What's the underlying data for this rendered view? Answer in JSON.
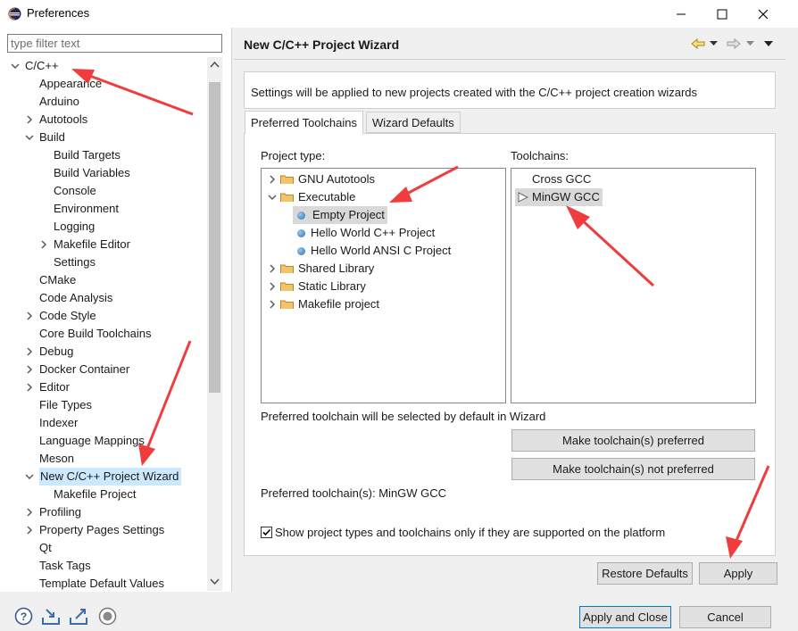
{
  "window": {
    "title": "Preferences"
  },
  "filter": {
    "placeholder": "type filter text"
  },
  "tree": [
    {
      "label": "C/C++",
      "level": 0,
      "arrow": "down"
    },
    {
      "label": "Appearance",
      "level": 1,
      "arrow": ""
    },
    {
      "label": "Arduino",
      "level": 1,
      "arrow": ""
    },
    {
      "label": "Autotools",
      "level": 1,
      "arrow": "right"
    },
    {
      "label": "Build",
      "level": 1,
      "arrow": "down"
    },
    {
      "label": "Build Targets",
      "level": 2,
      "arrow": ""
    },
    {
      "label": "Build Variables",
      "level": 2,
      "arrow": ""
    },
    {
      "label": "Console",
      "level": 2,
      "arrow": ""
    },
    {
      "label": "Environment",
      "level": 2,
      "arrow": ""
    },
    {
      "label": "Logging",
      "level": 2,
      "arrow": ""
    },
    {
      "label": "Makefile Editor",
      "level": 2,
      "arrow": "right"
    },
    {
      "label": "Settings",
      "level": 2,
      "arrow": ""
    },
    {
      "label": "CMake",
      "level": 1,
      "arrow": ""
    },
    {
      "label": "Code Analysis",
      "level": 1,
      "arrow": ""
    },
    {
      "label": "Code Style",
      "level": 1,
      "arrow": "right"
    },
    {
      "label": "Core Build Toolchains",
      "level": 1,
      "arrow": ""
    },
    {
      "label": "Debug",
      "level": 1,
      "arrow": "right"
    },
    {
      "label": "Docker Container",
      "level": 1,
      "arrow": "right"
    },
    {
      "label": "Editor",
      "level": 1,
      "arrow": "right"
    },
    {
      "label": "File Types",
      "level": 1,
      "arrow": ""
    },
    {
      "label": "Indexer",
      "level": 1,
      "arrow": ""
    },
    {
      "label": "Language Mappings",
      "level": 1,
      "arrow": ""
    },
    {
      "label": "Meson",
      "level": 1,
      "arrow": ""
    },
    {
      "label": "New C/C++ Project Wizard",
      "level": 1,
      "arrow": "down",
      "selected": true
    },
    {
      "label": "Makefile Project",
      "level": 2,
      "arrow": ""
    },
    {
      "label": "Profiling",
      "level": 1,
      "arrow": "right"
    },
    {
      "label": "Property Pages Settings",
      "level": 1,
      "arrow": "right"
    },
    {
      "label": "Qt",
      "level": 1,
      "arrow": ""
    },
    {
      "label": "Task Tags",
      "level": 1,
      "arrow": ""
    },
    {
      "label": "Template Default Values",
      "level": 1,
      "arrow": ""
    }
  ],
  "page": {
    "title": "New C/C++ Project Wizard",
    "description": "Settings will be applied to new projects created with the C/C++ project creation wizards"
  },
  "tabs": [
    {
      "label": "Preferred Toolchains",
      "active": true
    },
    {
      "label": "Wizard Defaults",
      "active": false
    }
  ],
  "project_type": {
    "label": "Project type:",
    "items": [
      {
        "label": "GNU Autotools",
        "kind": "folder",
        "arrow": "right"
      },
      {
        "label": "Executable",
        "kind": "folder",
        "arrow": "down"
      },
      {
        "label": "Empty Project",
        "kind": "item",
        "selected": true
      },
      {
        "label": "Hello World C++ Project",
        "kind": "item"
      },
      {
        "label": "Hello World ANSI C Project",
        "kind": "item"
      },
      {
        "label": "Shared Library",
        "kind": "folder",
        "arrow": "right"
      },
      {
        "label": "Static Library",
        "kind": "folder",
        "arrow": "right"
      },
      {
        "label": "Makefile project",
        "kind": "folder",
        "arrow": "right"
      }
    ]
  },
  "toolchains": {
    "label": "Toolchains:",
    "items": [
      {
        "label": "Cross GCC",
        "preferred": false
      },
      {
        "label": "MinGW GCC",
        "preferred": true,
        "selected": true
      }
    ]
  },
  "info_text": "Preferred toolchain will be selected by default in Wizard",
  "buttons": {
    "make_preferred": "Make toolchain(s) preferred",
    "make_not_preferred": "Make toolchain(s) not preferred",
    "restore_defaults": "Restore Defaults",
    "apply": "Apply",
    "apply_close": "Apply and Close",
    "cancel": "Cancel"
  },
  "preferred_status": "Preferred toolchain(s): MinGW GCC",
  "checkbox": {
    "label": "Show project types and toolchains only if they are supported on the platform",
    "checked": true
  },
  "colors": {
    "selection": "#cce8ff",
    "annotation_arrow": "#f03c3c",
    "accent": "#0078d7"
  }
}
